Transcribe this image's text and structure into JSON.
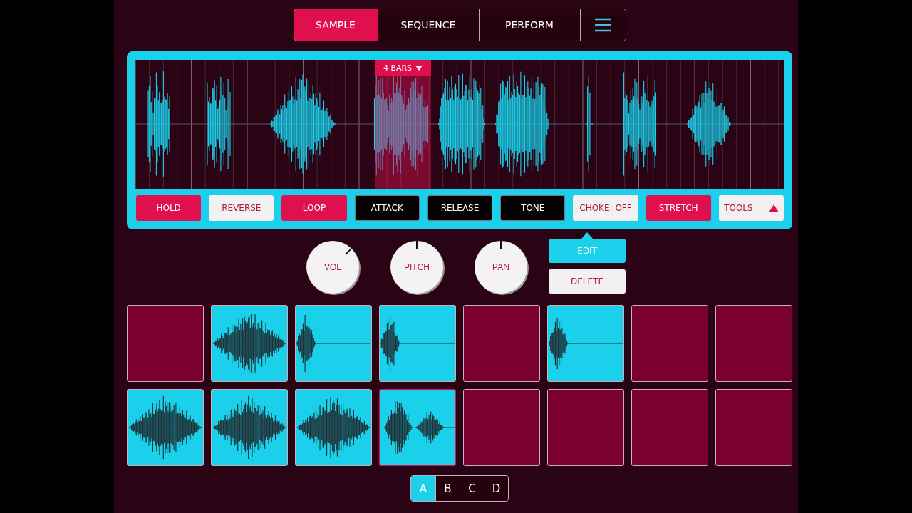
{
  "tabs": [
    {
      "label": "SAMPLE",
      "selected": true
    },
    {
      "label": "SEQUENCE",
      "selected": false
    },
    {
      "label": "PERFORM",
      "selected": false
    }
  ],
  "waveform": {
    "region": {
      "label": "4 BARS"
    }
  },
  "controls": [
    {
      "label": "HOLD",
      "kind": "toggle",
      "on": true
    },
    {
      "label": "REVERSE",
      "kind": "toggle",
      "on": false
    },
    {
      "label": "LOOP",
      "kind": "toggle",
      "on": true
    },
    {
      "label": "ATTACK",
      "kind": "param"
    },
    {
      "label": "RELEASE",
      "kind": "param"
    },
    {
      "label": "TONE",
      "kind": "param"
    },
    {
      "label": "CHOKE: OFF",
      "kind": "toggle",
      "on": false
    },
    {
      "label": "STRETCH",
      "kind": "toggle",
      "on": true
    },
    {
      "label": "TOOLS",
      "kind": "menu"
    }
  ],
  "knobs": [
    {
      "label": "VOL"
    },
    {
      "label": "PITCH"
    },
    {
      "label": "PAN"
    }
  ],
  "popup": {
    "edit": "EDIT",
    "delete": "DELETE"
  },
  "pads": [
    {
      "kind": "empty",
      "selected": false
    },
    {
      "kind": "burst",
      "selected": false
    },
    {
      "kind": "decay",
      "selected": false
    },
    {
      "kind": "decay",
      "selected": false
    },
    {
      "kind": "empty",
      "selected": false
    },
    {
      "kind": "decay",
      "selected": false
    },
    {
      "kind": "empty",
      "selected": false
    },
    {
      "kind": "empty",
      "selected": false
    },
    {
      "kind": "burst",
      "selected": false
    },
    {
      "kind": "burst",
      "selected": false
    },
    {
      "kind": "burst",
      "selected": false
    },
    {
      "kind": "double",
      "selected": true
    },
    {
      "kind": "empty",
      "selected": false
    },
    {
      "kind": "empty",
      "selected": false
    },
    {
      "kind": "empty",
      "selected": false
    },
    {
      "kind": "empty",
      "selected": false
    }
  ],
  "banks": [
    {
      "label": "A",
      "selected": true
    },
    {
      "label": "B",
      "selected": false
    },
    {
      "label": "C",
      "selected": false
    },
    {
      "label": "D",
      "selected": false
    }
  ]
}
